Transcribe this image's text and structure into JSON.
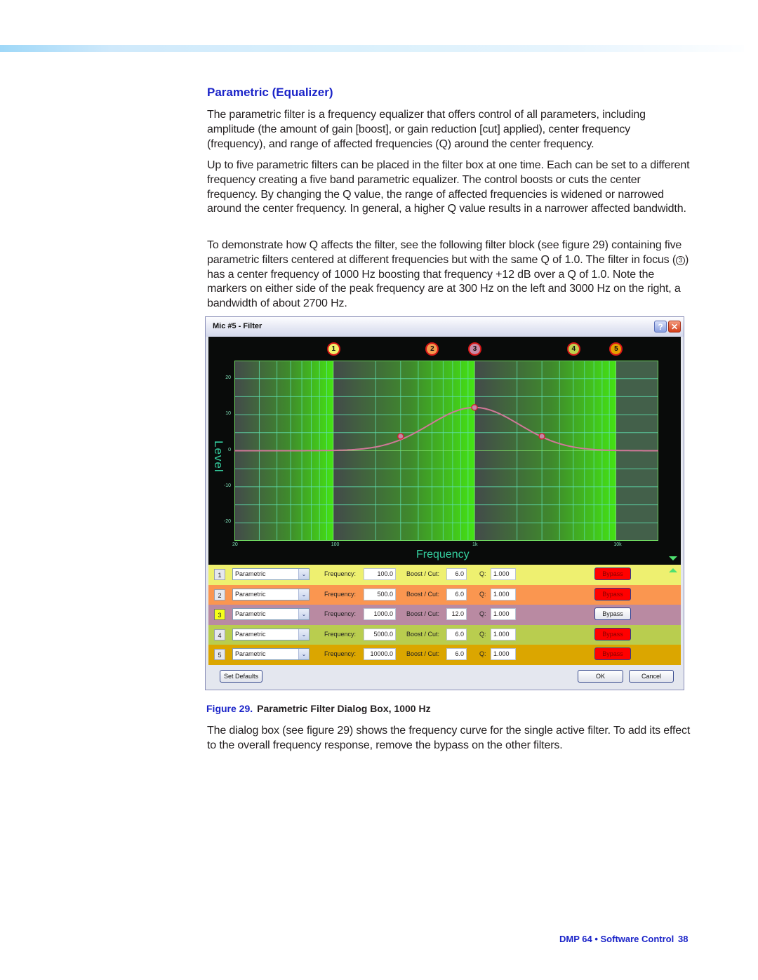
{
  "section": {
    "heading": "Parametric (Equalizer)",
    "paragraphs": [
      "The parametric filter is a frequency equalizer that offers control of all parameters, including amplitude (the amount of gain [boost], or gain reduction [cut] applied), center frequency (frequency), and range of affected frequencies (Q) around the center frequency.",
      "Up to five parametric filters can be placed in the filter box at one time. Each can be set to a different frequency creating a five band parametric equalizer. The control boosts or cuts the center frequency. By changing the Q value, the range of affected frequencies is widened or narrowed around the center frequency. In general, a higher Q value results in a narrower affected bandwidth.",
      {
        "before": "To demonstrate how Q affects the filter, see the following filter block (see figure 29) containing five parametric filters centered at different frequencies but with the same Q of 1.0. The filter in focus (",
        "circled": "3",
        "after": ") has a center frequency of 1000 Hz boosting that frequency +12 dB over a Q of 1.0. Note the markers on either side of the peak frequency are at 300 Hz on the left and 3000 Hz on the right, a bandwidth of about 2700 Hz."
      },
      "The dialog box (see figure 29) shows the frequency curve for the single active filter. To add its effect to the overall frequency response, remove the bypass on the other filters."
    ]
  },
  "dialog": {
    "title": "Mic #5 - Filter",
    "help_icon": "?",
    "close_icon": "✕",
    "y_axis_label": "Level",
    "x_axis_label": "Frequency",
    "filters": [
      {
        "index": "1",
        "type": "Parametric",
        "frequency": "100.0",
        "boost_cut": "6.0",
        "q": "1.000",
        "bypass": true,
        "color": "#eef070",
        "badge_color": "#f1f16a"
      },
      {
        "index": "2",
        "type": "Parametric",
        "frequency": "500.0",
        "boost_cut": "6.0",
        "q": "1.000",
        "bypass": true,
        "color": "#fa9650",
        "badge_color": "#f39a4e"
      },
      {
        "index": "3",
        "type": "Parametric",
        "frequency": "1000.0",
        "boost_cut": "12.0",
        "q": "1.000",
        "bypass": false,
        "color": "#b98aa2",
        "badge_color": "#c88aa5",
        "selected": true
      },
      {
        "index": "4",
        "type": "Parametric",
        "frequency": "5000.0",
        "boost_cut": "6.0",
        "q": "1.000",
        "bypass": true,
        "color": "#b9cd4f",
        "badge_color": "#bfd04e"
      },
      {
        "index": "5",
        "type": "Parametric",
        "frequency": "10000.0",
        "boost_cut": "6.0",
        "q": "1.000",
        "bypass": true,
        "color": "#dba600",
        "badge_color": "#e6a000"
      }
    ],
    "labels": {
      "frequency": "Frequency:",
      "boost_cut": "Boost / Cut:",
      "q": "Q:",
      "bypass": "Bypass",
      "dropdown_arrow": "⌄"
    },
    "buttons": {
      "set_defaults": "Set Defaults",
      "ok": "OK",
      "cancel": "Cancel"
    }
  },
  "chart_data": {
    "type": "line",
    "title": "",
    "xlabel": "Frequency",
    "ylabel": "Level",
    "x_scale": "log",
    "xlim": [
      20,
      20000
    ],
    "ylim": [
      -25,
      25
    ],
    "x_ticks": [
      {
        "value": 20,
        "label": "20"
      },
      {
        "value": 100,
        "label": "100"
      },
      {
        "value": 1000,
        "label": "1k"
      },
      {
        "value": 10000,
        "label": "10k"
      }
    ],
    "y_ticks": [
      {
        "value": 20,
        "label": "20"
      },
      {
        "value": 10,
        "label": "10"
      },
      {
        "value": 0,
        "label": "0"
      },
      {
        "value": -10,
        "label": "-10"
      },
      {
        "value": -20,
        "label": "-20"
      }
    ],
    "grid": true,
    "series": [
      {
        "name": "Filter 3 response",
        "center_hz": 1000,
        "gain_db": 12,
        "q": 1.0,
        "x": [
          20,
          50,
          100,
          200,
          300,
          500,
          700,
          1000,
          1500,
          2000,
          3000,
          5000,
          10000,
          20000
        ],
        "y": [
          -0.2,
          0,
          0.4,
          1.8,
          4,
          7.5,
          10.2,
          12,
          10,
          7.5,
          4,
          1.6,
          0.4,
          -0.1
        ]
      }
    ],
    "markers": [
      {
        "x": 300,
        "y": 4,
        "label": "lower bandwidth marker"
      },
      {
        "x": 1000,
        "y": 12,
        "label": "center frequency"
      },
      {
        "x": 3000,
        "y": 4,
        "label": "upper bandwidth marker"
      }
    ],
    "band_badges": [
      "1",
      "2",
      "3",
      "4",
      "5"
    ],
    "band_frequencies": [
      100,
      500,
      1000,
      5000,
      10000
    ]
  },
  "caption": {
    "figure_label": "Figure 29.",
    "text": "Parametric Filter Dialog Box, 1000 Hz"
  },
  "footer": {
    "text": "DMP 64 • Software Control",
    "page_number": "38"
  }
}
